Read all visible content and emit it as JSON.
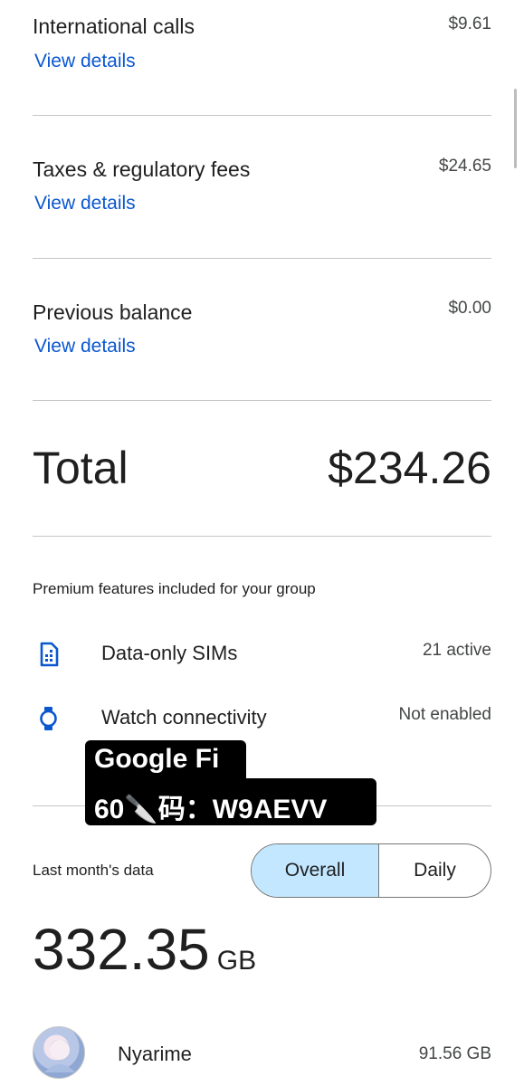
{
  "rows": [
    {
      "title": "International calls",
      "amount": "$9.61",
      "link": "View details"
    },
    {
      "title": "Taxes & regulatory fees",
      "amount": "$24.65",
      "link": "View details"
    },
    {
      "title": "Previous balance",
      "amount": "$0.00",
      "link": "View details"
    }
  ],
  "total": {
    "label": "Total",
    "value": "$234.26"
  },
  "premium": {
    "header": "Premium features included for your group",
    "features": [
      {
        "icon": "sim-card-icon",
        "label": "Data-only SIMs",
        "status": "21 active"
      },
      {
        "icon": "watch-icon",
        "label": "Watch connectivity",
        "status": "Not enabled"
      }
    ]
  },
  "overlay": {
    "line1": "Google Fi",
    "line2": "60🔪码：W9AEVV"
  },
  "data_usage": {
    "header": "Last month's data",
    "toggle": {
      "overall": "Overall",
      "daily": "Daily",
      "selected": "Overall"
    },
    "total_value": "332.35",
    "total_unit": "GB",
    "users": [
      {
        "name": "Nyarime",
        "usage": "91.56 GB"
      }
    ]
  },
  "colors": {
    "link": "#0b57d0",
    "toggle_selected": "#c2e7ff",
    "divider": "#c4c7c5"
  }
}
